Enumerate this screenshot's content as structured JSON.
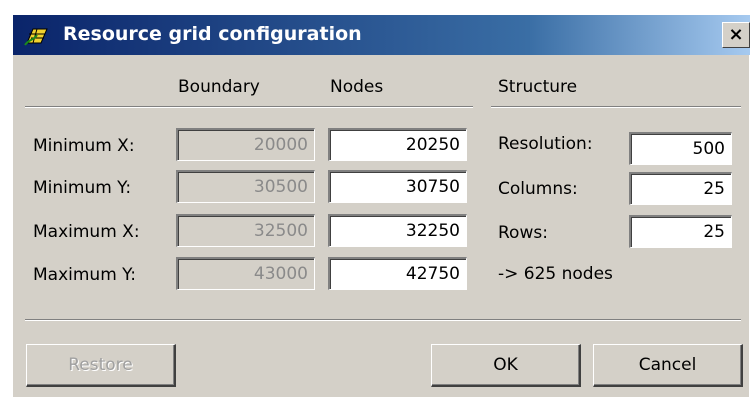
{
  "window": {
    "title": "Resource grid configuration",
    "close_glyph": "×",
    "icon": "grid-app-icon"
  },
  "headers": {
    "boundary": "Boundary",
    "nodes": "Nodes",
    "structure": "Structure"
  },
  "rows": [
    {
      "label": "Minimum X:",
      "boundary": "20000",
      "nodes": "20250"
    },
    {
      "label": "Minimum Y:",
      "boundary": "30500",
      "nodes": "30750"
    },
    {
      "label": "Maximum X:",
      "boundary": "32500",
      "nodes": "32250"
    },
    {
      "label": "Maximum Y:",
      "boundary": "43000",
      "nodes": "42750"
    }
  ],
  "structure": {
    "resolution_label": "Resolution:",
    "resolution_value": "500",
    "columns_label": "Columns:",
    "columns_value": "25",
    "rows_label": "Rows:",
    "rows_value": "25",
    "summary": "-> 625 nodes"
  },
  "buttons": {
    "restore": "Restore",
    "ok": "OK",
    "cancel": "Cancel"
  },
  "colors": {
    "title_gradient_start": "#0a246a",
    "title_gradient_end": "#a6caf0",
    "face": "#d4d0c8"
  }
}
